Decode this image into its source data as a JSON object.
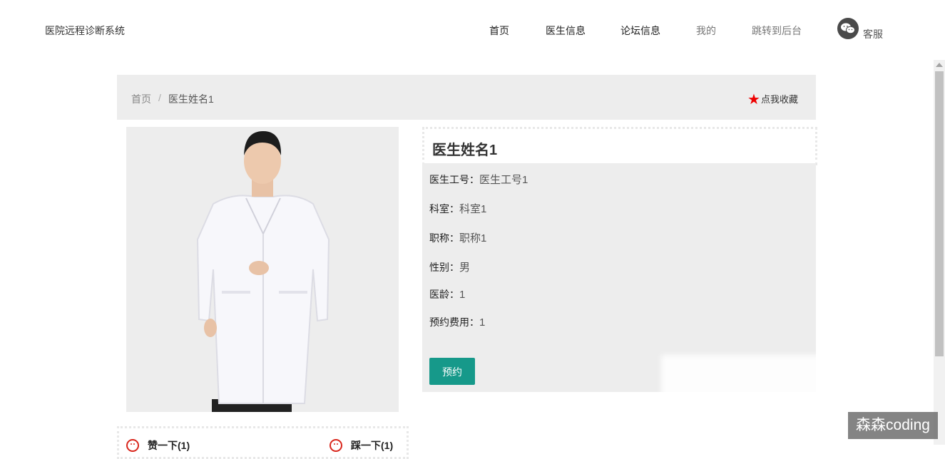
{
  "header": {
    "site_title": "医院远程诊断系统",
    "nav": [
      "首页",
      "医生信息",
      "论坛信息",
      "我的",
      "跳转到后台"
    ],
    "service_label": "客服"
  },
  "breadcrumb": {
    "home": "首页",
    "separator": "/",
    "current": "医生姓名1"
  },
  "favorite": {
    "star": "★",
    "label": "点我收藏"
  },
  "photo": {
    "icon": "doctor-photo"
  },
  "doctor": {
    "name": "医生姓名1",
    "fields": [
      {
        "label": "医生工号：",
        "value": "医生工号1"
      },
      {
        "label": "科室：",
        "value": "科室1"
      },
      {
        "label": "职称：",
        "value": "职称1"
      },
      {
        "label": "性别：",
        "value": "男"
      },
      {
        "label": "医龄：",
        "value": "1"
      },
      {
        "label": "预约费用：",
        "value": "1"
      }
    ],
    "book_button": "预约"
  },
  "actions": {
    "like": "赞一下(1)",
    "dislike": "踩一下(1)"
  },
  "watermark": "森森coding",
  "colors": {
    "accent": "#16998a",
    "star": "#ee0000",
    "panel": "#ededed",
    "face": "#d9261c"
  }
}
